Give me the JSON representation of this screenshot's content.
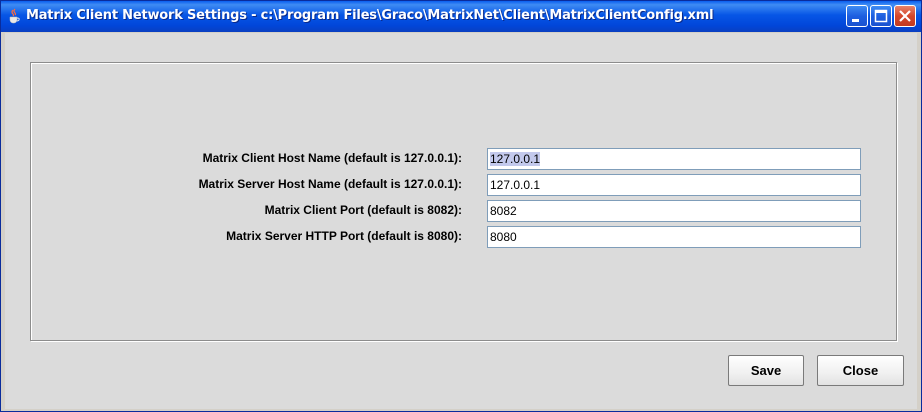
{
  "window": {
    "title": "Matrix Client Network Settings - c:\\Program Files\\Graco\\MatrixNet\\Client\\MatrixClientConfig.xml",
    "minimize_icon": "minimize-icon",
    "maximize_icon": "maximize-icon",
    "close_icon": "close-icon",
    "app_icon": "java-cup-icon"
  },
  "form": {
    "fields": [
      {
        "label": "Matrix Client Host Name (default is 127.0.0.1):",
        "value": "127.0.0.1"
      },
      {
        "label": "Matrix Server Host Name (default is 127.0.0.1):",
        "value": "127.0.0.1"
      },
      {
        "label": "Matrix Client Port (default is 8082):",
        "value": "8082"
      },
      {
        "label": "Matrix Server HTTP Port (default is 8080):",
        "value": "8080"
      }
    ]
  },
  "buttons": {
    "save": "Save",
    "close": "Close"
  }
}
